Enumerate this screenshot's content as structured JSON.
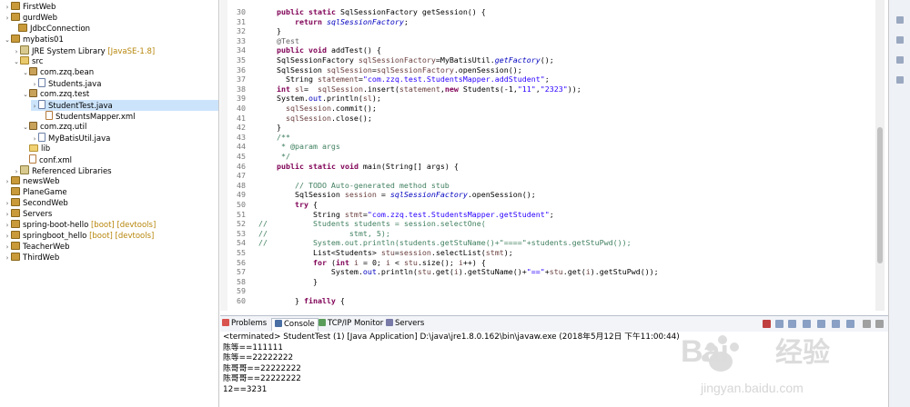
{
  "explorer": {
    "items": [
      {
        "label": "FirstWeb",
        "deco": "",
        "icon": "proj-icon",
        "twisty": "›"
      },
      {
        "label": "gurdWeb",
        "deco": "",
        "icon": "proj-icon",
        "twisty": "›"
      },
      {
        "label": "JdbcConnection",
        "deco": "",
        "icon": "proj-icon",
        "twisty": ""
      },
      {
        "label": "mybatis01",
        "deco": "",
        "icon": "proj-icon",
        "twisty": "⌄"
      },
      {
        "label": "JRE System Library",
        "deco": "[JavaSE-1.8]",
        "icon": "library-icon",
        "twisty": "›"
      },
      {
        "label": "src",
        "deco": "",
        "icon": "src-folder-icon",
        "twisty": "⌄"
      },
      {
        "label": "com.zzq.bean",
        "deco": "",
        "icon": "package-icon",
        "twisty": "⌄"
      },
      {
        "label": "Students.java",
        "deco": "",
        "icon": "java-file-icon",
        "twisty": "›"
      },
      {
        "label": "com.zzq.test",
        "deco": "",
        "icon": "package-icon",
        "twisty": "⌄"
      },
      {
        "label": "StudentTest.java",
        "deco": "",
        "icon": "java-file-icon",
        "twisty": "›"
      },
      {
        "label": "StudentsMapper.xml",
        "deco": "",
        "icon": "xml-file-icon",
        "twisty": ""
      },
      {
        "label": "com.zzq.util",
        "deco": "",
        "icon": "package-icon",
        "twisty": "⌄"
      },
      {
        "label": "MyBatisUtil.java",
        "deco": "",
        "icon": "java-file-icon",
        "twisty": "›"
      },
      {
        "label": "lib",
        "deco": "",
        "icon": "folder-icon",
        "twisty": ""
      },
      {
        "label": "conf.xml",
        "deco": "",
        "icon": "xml-file-icon",
        "twisty": ""
      },
      {
        "label": "Referenced Libraries",
        "deco": "",
        "icon": "library-icon",
        "twisty": "›"
      },
      {
        "label": "newsWeb",
        "deco": "",
        "icon": "proj-icon",
        "twisty": "›"
      },
      {
        "label": "PlaneGame",
        "deco": "",
        "icon": "proj-icon",
        "twisty": ""
      },
      {
        "label": "SecondWeb",
        "deco": "",
        "icon": "proj-icon",
        "twisty": "›"
      },
      {
        "label": "Servers",
        "deco": "",
        "icon": "proj-icon",
        "twisty": "›"
      },
      {
        "label": "spring-boot-hello",
        "deco": "[boot] [devtools]",
        "icon": "proj-icon",
        "twisty": "›"
      },
      {
        "label": "springboot_hello",
        "deco": "[boot] [devtools]",
        "icon": "proj-icon",
        "twisty": "›"
      },
      {
        "label": "TeacherWeb",
        "deco": "",
        "icon": "proj-icon",
        "twisty": "›"
      },
      {
        "label": "ThirdWeb",
        "deco": "",
        "icon": "proj-icon",
        "twisty": "›"
      }
    ]
  },
  "editor": {
    "lines": [
      {
        "n": "30",
        "t": "    <k>public</k> <k>static</k> SqlSessionFactory getSession() {"
      },
      {
        "n": "31",
        "t": "        <k>return</k> <s>sqlSessionFactory</s>;"
      },
      {
        "n": "32",
        "t": "    }"
      },
      {
        "n": "33",
        "t": "    <a>@Test</a>"
      },
      {
        "n": "34",
        "t": "    <k>public</k> <k>void</k> addTest() {"
      },
      {
        "n": "35",
        "t": "    SqlSessionFactory <v>sqlSessionFactory</v>=MyBatisUtil.<i>getFactory</i>();"
      },
      {
        "n": "36",
        "t": "    SqlSession <v>sqlSession</v>=<v>sqlSessionFactory</v>.openSession();"
      },
      {
        "n": "37",
        "t": "      String <v>statement</v>=<q>\"com.zzq.test.StudentsMapper.addStudent\"</q>;"
      },
      {
        "n": "38",
        "t": "    <k>int</k> <v>sl</v>=  <v>sqlSession</v>.insert(<v>statement</v>,<k>new</k> Students(-1,<q>\"11\"</q>,<q>\"2323\"</q>));"
      },
      {
        "n": "39",
        "t": "    System.<f>out</f>.println(<v>sl</v>);"
      },
      {
        "n": "40",
        "t": "      <v>sqlSession</v>.commit();"
      },
      {
        "n": "41",
        "t": "      <v>sqlSession</v>.close();"
      },
      {
        "n": "42",
        "t": "    }"
      },
      {
        "n": "43",
        "t": "    <c>/**</c>"
      },
      {
        "n": "44",
        "t": "     <c>* @param args</c>"
      },
      {
        "n": "45",
        "t": "     <c>*/</c>"
      },
      {
        "n": "46",
        "t": "    <k>public</k> <k>static</k> <k>void</k> main(String[] args) {"
      },
      {
        "n": "47",
        "t": ""
      },
      {
        "n": "48",
        "t": "        <c>// TODO Auto-generated method stub</c>"
      },
      {
        "n": "49",
        "t": "        SqlSession <v>session</v> = <s>sqlSessionFactory</s>.openSession();"
      },
      {
        "n": "50",
        "t": "        <k>try</k> {"
      },
      {
        "n": "51",
        "t": "            String <v>stmt</v>=<q>\"com.zzq.test.StudentsMapper.getStudent\"</q>;"
      },
      {
        "n": "52",
        "t": "<c>//          Students students = session.selectOne(</c>"
      },
      {
        "n": "53",
        "t": "<c>//                  stmt, 5);</c>"
      },
      {
        "n": "54",
        "t": "<c>//          System.out.println(students.getStuName()+\"====\"+students.getStuPwd());</c>"
      },
      {
        "n": "55",
        "t": "            List&lt;Students&gt; <v>stu</v>=<v>session</v>.selectList(<v>stmt</v>);"
      },
      {
        "n": "56",
        "t": "            <k>for</k> (<k>int</k> <v>i</v> = 0; <v>i</v> &lt; <v>stu</v>.size(); <v>i</v>++) {"
      },
      {
        "n": "57",
        "t": "                System.<f>out</f>.println(<v>stu</v>.get(<v>i</v>).getStuName()+<q>\"==\"</q>+<v>stu</v>.get(<v>i</v>).getStuPwd());"
      },
      {
        "n": "58",
        "t": "            }"
      },
      {
        "n": "59",
        "t": ""
      },
      {
        "n": "60",
        "t": "        } <k>finally</k> {"
      }
    ]
  },
  "console": {
    "tabs": [
      {
        "label": "Problems",
        "icon": "problems-icon"
      },
      {
        "label": "Console",
        "icon": "console-icon",
        "active": true
      },
      {
        "label": "TCP/IP Monitor",
        "icon": "tcpip-icon"
      },
      {
        "label": "Servers",
        "icon": "servers-icon"
      }
    ],
    "lines": [
      "<terminated> StudentTest (1) [Java Application] D:\\java\\jre1.8.0.162\\bin\\javaw.exe (2018年5月12日 下午11:00:44)",
      "陈等==111111",
      "陈等==22222222",
      "陈哥哥==22222222",
      "陈哥哥==22222222",
      "12==3231"
    ]
  },
  "watermark": {
    "brand": "Bai",
    "brand2": "经验",
    "site": "jingyan.baidu.com"
  },
  "colors": {
    "keyword": "#7f0055",
    "string": "#2a00ff",
    "comment": "#3f7f5f",
    "static": "#0000c0",
    "variable": "#6a3e3e"
  }
}
